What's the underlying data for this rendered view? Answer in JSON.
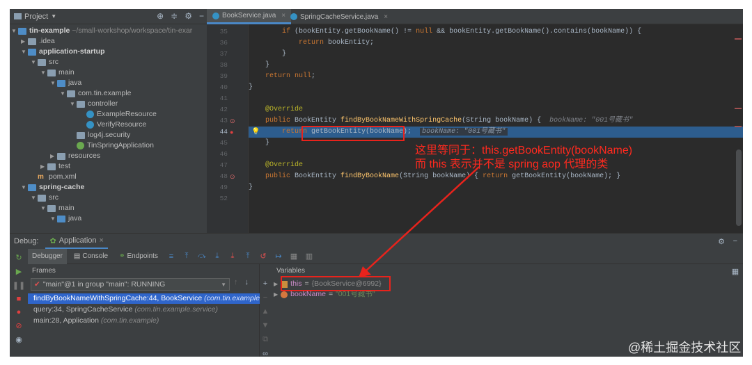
{
  "project": {
    "title": "Project",
    "tree": [
      {
        "label": "tin-example",
        "suffix": "~/small-workshop/workspace/tin-exar",
        "bold": true
      },
      {
        "label": ".idea"
      },
      {
        "label": "application-startup",
        "bold": true
      },
      {
        "label": "src"
      },
      {
        "label": "main"
      },
      {
        "label": "java"
      },
      {
        "label": "com.tin.example"
      },
      {
        "label": "controller"
      },
      {
        "label": "ExampleResource"
      },
      {
        "label": "VerifyResource"
      },
      {
        "label": "log4j.security"
      },
      {
        "label": "TinSpringApplication"
      },
      {
        "label": "resources"
      },
      {
        "label": "test"
      },
      {
        "label": "pom.xml"
      },
      {
        "label": "spring-cache",
        "bold": true
      },
      {
        "label": "src"
      },
      {
        "label": "main"
      },
      {
        "label": "java"
      }
    ]
  },
  "editor": {
    "tabs": [
      "BookService.java",
      "SpringCacheService.java"
    ],
    "lines": [
      {
        "num": "35",
        "code": "        if (bookEntity.getBookName() != null && bookEntity.getBookName().contains(bookName)) {"
      },
      {
        "num": "36",
        "code": "            return bookEntity;"
      },
      {
        "num": "37",
        "code": "        }"
      },
      {
        "num": "38",
        "code": "    }"
      },
      {
        "num": "39",
        "code": "    return null;"
      },
      {
        "num": "40",
        "code": "}"
      },
      {
        "num": "41",
        "code": ""
      },
      {
        "num": "42",
        "code": "@Override"
      },
      {
        "num": "43",
        "code": "public BookEntity findByBookNameWithSpringCache(String bookName) {"
      },
      {
        "num": "44",
        "code": "    return getBookEntity(bookName);"
      },
      {
        "num": "45",
        "code": "}"
      },
      {
        "num": "46",
        "code": ""
      },
      {
        "num": "47",
        "code": "@Override"
      },
      {
        "num": "48",
        "code": "public BookEntity findByBookName(String bookName) { return getBookEntity(bookName); }"
      },
      {
        "num": "49",
        "code": "}"
      },
      {
        "num": "52",
        "code": ""
      }
    ],
    "hint43": "bookName: \"001号藏书\"",
    "hint44": "bookName: \"001号藏书\""
  },
  "debug": {
    "title": "Debug:",
    "app_tab": "Application",
    "tabs": [
      "Debugger",
      "Console",
      "Endpoints"
    ],
    "frames_label": "Frames",
    "thread": "\"main\"@1 in group \"main\": RUNNING",
    "frames": [
      {
        "method": "findByBookNameWithSpringCache:44, BookService",
        "loc": "(com.tin.example"
      },
      {
        "method": "query:34, SpringCacheService",
        "loc": "(com.tin.example.service)"
      },
      {
        "method": "main:28, Application",
        "loc": "(com.tin.example)"
      }
    ],
    "variables_label": "Variables",
    "variables": [
      {
        "name": "this",
        "eq": " = ",
        "value": "{BookService@6992}"
      },
      {
        "name": "bookName",
        "eq": " = ",
        "value": "\"001号藏书\""
      }
    ]
  },
  "annotation": {
    "line1": "这里等同于：this.getBookEntity(bookName)",
    "line2": "而 this 表示并不是 spring aop 代理的类"
  },
  "watermark": "@稀土掘金技术社区",
  "colors": {
    "accent": "#4a88c7",
    "highlight": "#2d5d8e",
    "annotation_red": "#e8231c"
  }
}
